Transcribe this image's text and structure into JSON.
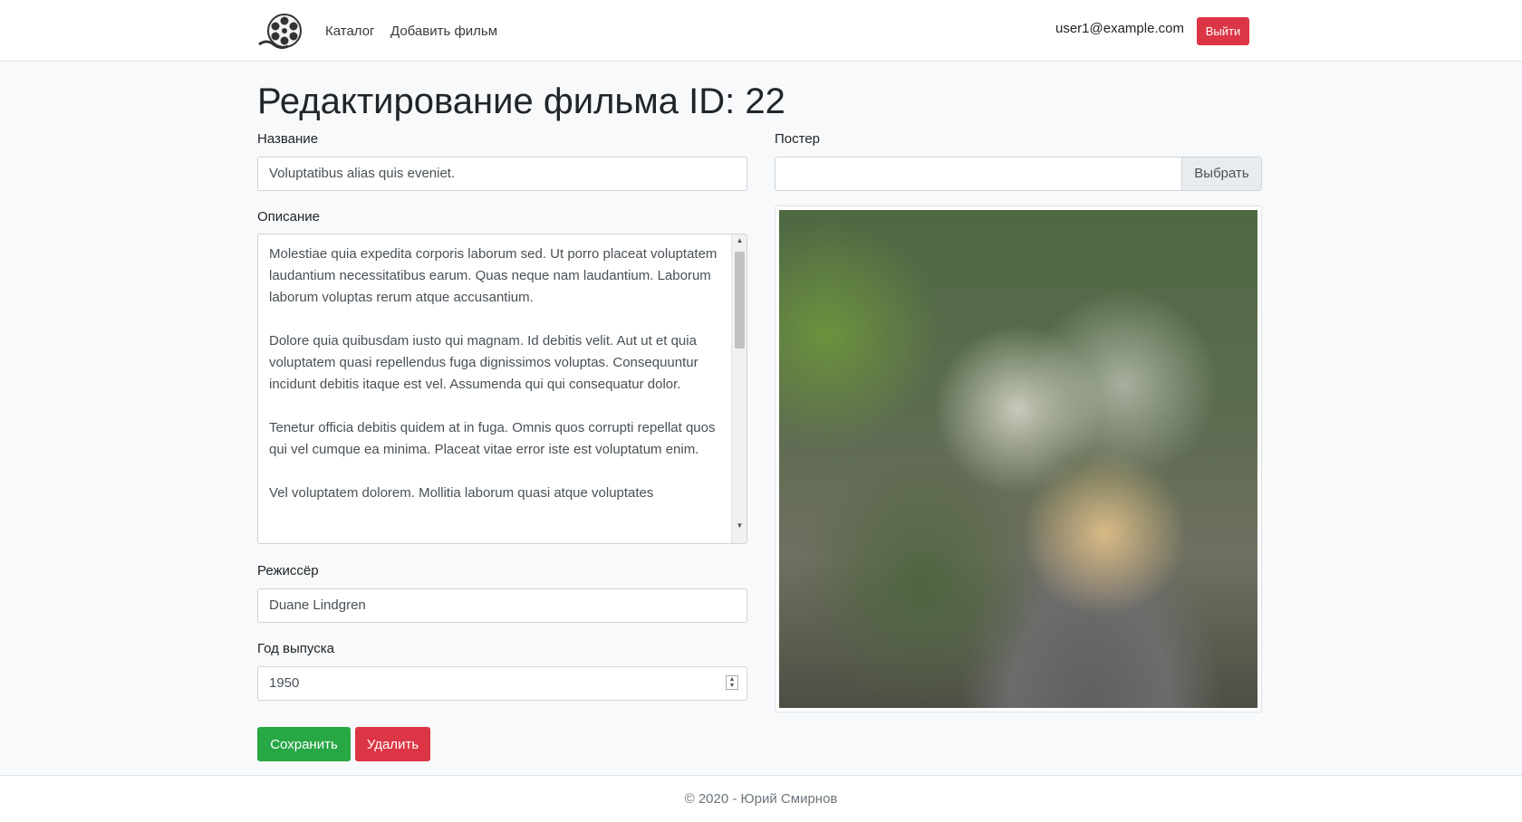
{
  "navbar": {
    "logo_icon": "film-reel-icon",
    "links": [
      "Каталог",
      "Добавить фильм"
    ],
    "user_email": "user1@example.com",
    "logout_label": "Выйти"
  },
  "page": {
    "title": "Редактирование фильма ID: 22"
  },
  "form": {
    "name_label": "Название",
    "name_value": "Voluptatibus alias quis eveniet.",
    "description_label": "Описание",
    "description_paragraphs": [
      "Molestiae quia expedita corporis laborum sed. Ut porro placeat voluptatem laudantium necessitatibus earum. Quas neque nam laudantium. Laborum laborum voluptas rerum atque accusantium.",
      "Dolore quia quibusdam iusto qui magnam. Id debitis velit. Aut ut et quia voluptatem quasi repellendus fuga dignissimos voluptas. Consequuntur incidunt debitis itaque est vel. Assumenda qui qui consequatur dolor.",
      "Tenetur officia debitis quidem at in fuga. Omnis quos corrupti repellat quos qui vel cumque ea minima. Placeat vitae error iste est voluptatum enim.",
      "Vel voluptatem dolorem. Mollitia laborum quasi atque voluptates"
    ],
    "director_label": "Режиссёр",
    "director_value": "Duane Lindgren",
    "year_label": "Год выпуска",
    "year_value": "1950",
    "poster_label": "Постер",
    "poster_value": "",
    "poster_button": "Выбрать",
    "save_label": "Сохранить",
    "delete_label": "Удалить"
  },
  "footer": {
    "text": "© 2020 - Юрий Смирнов"
  },
  "colors": {
    "success": "#28a745",
    "danger": "#dc3545",
    "background": "#f8f9fa"
  }
}
